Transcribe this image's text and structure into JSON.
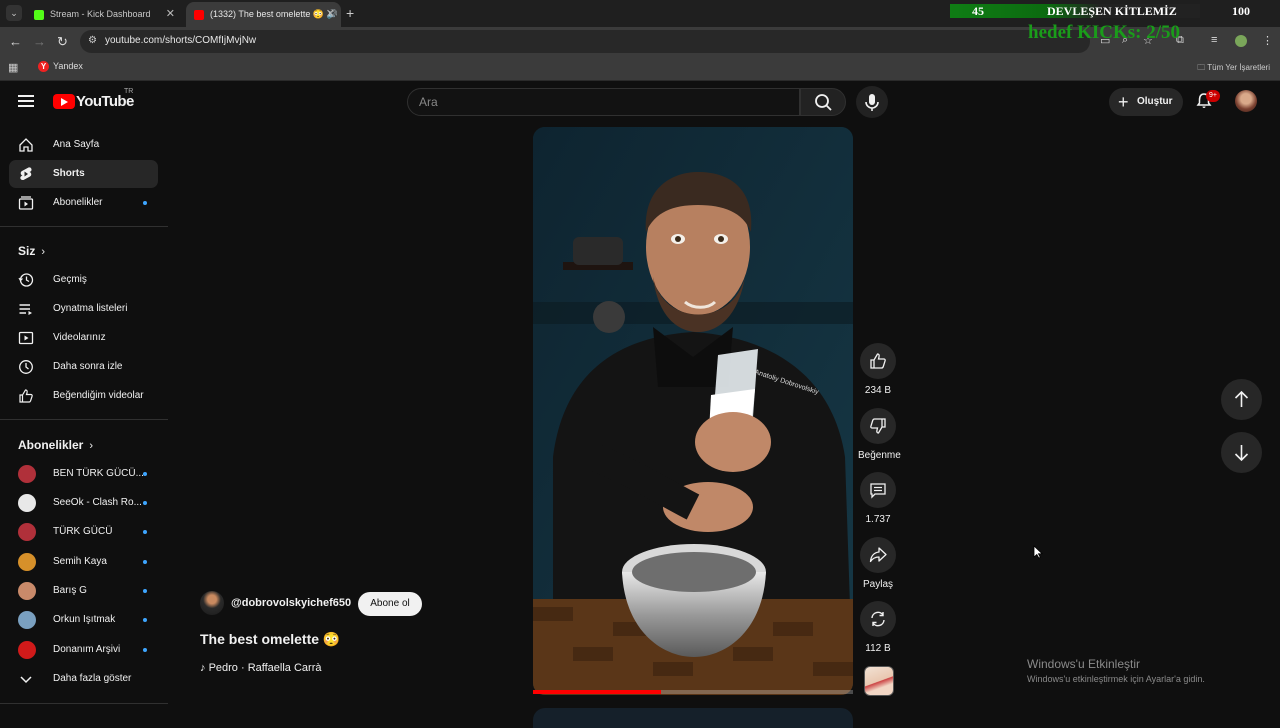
{
  "browser": {
    "tabs": [
      {
        "title": "Stream - Kick Dashboard",
        "favicon_color": "#53fc18"
      },
      {
        "title": "(1332) The best omelette 😳 🔊",
        "favicon_color": "#ff0000"
      }
    ],
    "url": "youtube.com/shorts/COMfIjMvjNw",
    "bookmarks": [
      {
        "label": "Yandex"
      }
    ],
    "all_bookmarks_label": "Tüm Yer İşaretleri"
  },
  "stream_overlay": {
    "left_number": "45",
    "title": "DEVLEŞEN KİTLEMİZ",
    "right_number": "100",
    "kicks_goal": "hedef KICKs: 2/50"
  },
  "youtube": {
    "logo_text": "YouTube",
    "country_code": "TR",
    "search_placeholder": "Ara",
    "create_label": "Oluştur",
    "notification_badge": "9+"
  },
  "sidebar": {
    "main": [
      {
        "label": "Ana Sayfa",
        "icon": "home-icon"
      },
      {
        "label": "Shorts",
        "icon": "shorts-icon",
        "active": true
      },
      {
        "label": "Abonelikler",
        "icon": "subscriptions-icon",
        "dot": true
      }
    ],
    "you_heading": "Siz",
    "you": [
      {
        "label": "Geçmiş",
        "icon": "history-icon"
      },
      {
        "label": "Oynatma listeleri",
        "icon": "playlists-icon"
      },
      {
        "label": "Videolarınız",
        "icon": "your-videos-icon"
      },
      {
        "label": "Daha sonra izle",
        "icon": "watch-later-icon"
      },
      {
        "label": "Beğendiğim videolar",
        "icon": "liked-videos-icon"
      }
    ],
    "subs_heading": "Abonelikler",
    "subscriptions": [
      {
        "label": "BEN TÜRK GÜCÜ...",
        "color": "#b0303a"
      },
      {
        "label": "SeeOk - Clash Ro...",
        "color": "#e8e8e8"
      },
      {
        "label": "TÜRK GÜCÜ",
        "color": "#b0303a"
      },
      {
        "label": "Semih Kaya",
        "color": "#d6902a"
      },
      {
        "label": "Barış G",
        "color": "#c98a6a"
      },
      {
        "label": "Orkun Işıtmak",
        "color": "#7aa0c0"
      },
      {
        "label": "Donanım Arşivi",
        "color": "#d01a1a"
      }
    ],
    "show_more": "Daha fazla göster"
  },
  "short": {
    "channel": "@dobrovolskyichef650",
    "subscribe_label": "Abone ol",
    "title": "The best omelette 😳",
    "music": "Pedro · Raffaella Carrà",
    "progress": 0.4,
    "apron_text": "Anatoliy Dobrovolskiy",
    "actions": {
      "likes": "234 B",
      "dislike_label": "Beğenme",
      "comments": "1.737",
      "share_label": "Paylaş",
      "remix": "112 B"
    }
  },
  "windows": {
    "activate_title": "Windows'u Etkinleştir",
    "activate_text": "Windows'u etkinleştirmek için Ayarlar'a gidin."
  }
}
